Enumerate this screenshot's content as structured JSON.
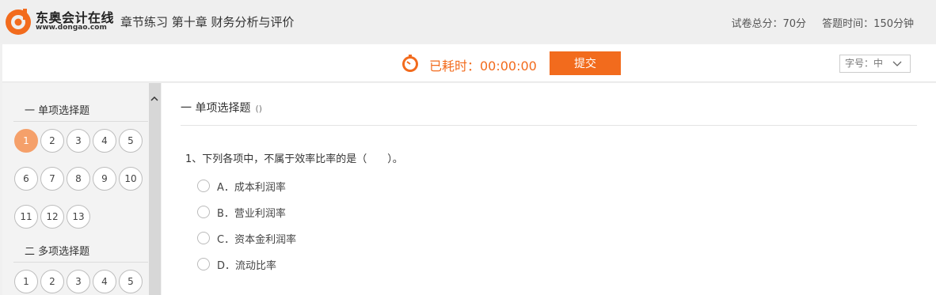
{
  "header": {
    "logo_name": "东奥会计在线",
    "logo_url": "www.dongao.com",
    "title": "章节练习 第十章 财务分析与评价",
    "total_score": "试卷总分：70分",
    "answer_time": "答题时间：150分钟"
  },
  "toolbar": {
    "timer_label": "已耗时：00:00:00",
    "submit_label": "提交",
    "font_size_label": "字号：中"
  },
  "sidebar": {
    "sections": [
      {
        "title": "一 单项选择题",
        "numbers": [
          "1",
          "2",
          "3",
          "4",
          "5",
          "6",
          "7",
          "8",
          "9",
          "10",
          "11",
          "12",
          "13"
        ],
        "active": "1"
      },
      {
        "title": "二 多项选择题",
        "numbers": [
          "1",
          "2",
          "3",
          "4",
          "5"
        ]
      }
    ]
  },
  "main": {
    "section_title": "一 单项选择题",
    "section_note": "()",
    "question": "1、下列各项中，不属于效率比率的是（　　）。",
    "options": [
      "A．成本利润率",
      "B．营业利润率",
      "C．资本金利润率",
      "D．流动比率"
    ]
  },
  "colors": {
    "accent": "#f26b1d",
    "active_number": "#f5a06a"
  },
  "icons": [
    "logo-mark-icon",
    "clock-icon",
    "chevron-down-icon",
    "scroll-up-icon"
  ]
}
